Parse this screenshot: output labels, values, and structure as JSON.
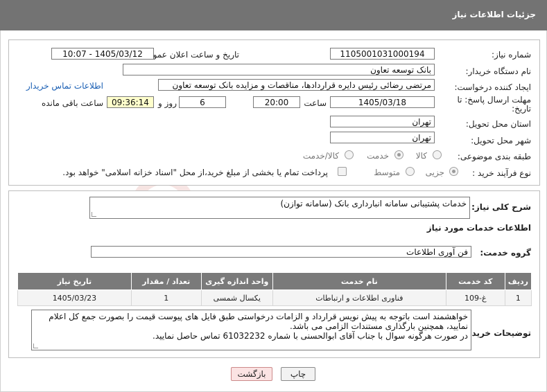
{
  "header": {
    "title": "جزئیات اطلاعات نیاز"
  },
  "labels": {
    "need_number": "شماره نیاز:",
    "announce_datetime": "تاریخ و ساعت اعلان عمومی:",
    "buyer_org": "نام دستگاه خریدار:",
    "requester": "ایجاد کننده درخواست:",
    "deadline": "مهلت ارسال پاسخ: تا",
    "deadline_date_word": "تاریخ:",
    "time_word": "ساعت",
    "day_and": "روز و",
    "remaining": "ساعت باقی مانده",
    "province": "استان محل تحویل:",
    "city": "شهر محل تحویل:",
    "category": "طبقه بندی موضوعی:",
    "process": "نوع فرآیند خرید :",
    "summary": "شرح کلی نیاز:",
    "services_info": "اطلاعات خدمات مورد نیاز",
    "service_group": "گروه خدمت:",
    "buyer_notes": "توضیحات خریدار:"
  },
  "values": {
    "need_number": "1105001031000194",
    "announce_datetime": "1405/03/12 - 10:07",
    "buyer_org": "بانک توسعه تعاون",
    "requester": "مرتضی رضائی رئیس دایره قراردادها، مناقصات و مزایده بانک توسعه تعاون",
    "buyer_contact_link": "اطلاعات تماس خریدار",
    "deadline_date": "1405/03/18",
    "deadline_time": "20:00",
    "days": "6",
    "remaining_time": "09:36:14",
    "province": "تهران",
    "city": "تهران",
    "summary": "خدمات پشتیبانی سامانه انبارداری بانک (سامانه توازن)",
    "service_group": "فن آوری اطلاعات"
  },
  "category_options": {
    "goods": "کالا",
    "service": "خدمت",
    "goods_service": "کالا/خدمت",
    "selected": "service"
  },
  "process_options": {
    "partial": "جزیی",
    "medium": "متوسط",
    "treasury_note": "پرداخت تمام یا بخشی از مبلغ خرید،از محل \"اسناد خزانه اسلامی\" خواهد بود.",
    "selected": "partial"
  },
  "table": {
    "headers": [
      "ردیف",
      "کد خدمت",
      "نام خدمت",
      "واحد اندازه گیری",
      "تعداد / مقدار",
      "تاریخ نیاز"
    ],
    "rows": [
      [
        "1",
        "غ-109",
        "فناوری اطلاعات و ارتباطات",
        "یکسال شمسی",
        "1",
        "1405/03/23"
      ]
    ]
  },
  "notes": {
    "line1": "خواهشمند است باتوجه به پیش نویس قرارداد و الزامات درخواستی طبق فایل های پیوست قیمت را بصورت جمع کل اعلام",
    "line2": "نمایید، همچنین بارگذاری مستندات الزامی می باشد.",
    "line3": "در صورت هرگونه سوال با جناب آقای ابوالحسنی با شماره 61032232 تماس حاصل نمایید."
  },
  "buttons": {
    "print": "چاپ",
    "back": "بازگشت"
  },
  "watermark": {
    "text": "AriaTender.net"
  },
  "colors": {
    "header_bg": "#737373",
    "table_header_bg": "#7a7a7a",
    "link": "#1a5fb4",
    "remaining_bg": "#ffffcc",
    "back_button_bg": "#fbe3e3"
  }
}
